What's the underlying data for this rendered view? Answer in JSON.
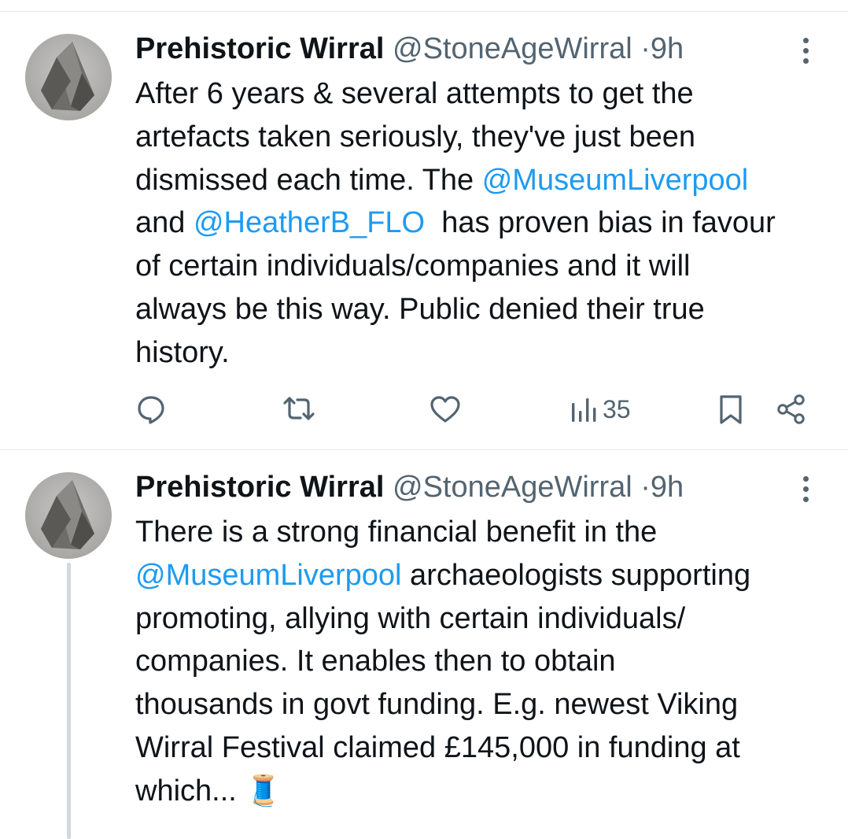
{
  "tweets": [
    {
      "name": "Prehistoric Wirral",
      "handle": "@StoneAgeWirral",
      "separator": "·",
      "time": "9h",
      "text": {
        "l1": "After 6 years & several attempts to get the",
        "l2": "artefacts taken seriously, they've just been",
        "l3a": "dismissed each time. The ",
        "l3b": "@MuseumLiverpool",
        "l4a": "and ",
        "l4b": "@HeatherB_FLO",
        "l4c": "  has proven bias in favour",
        "l5": "of certain individuals/companies and it will",
        "l6": "always be this way. Public denied their true",
        "l7": "history."
      },
      "actions": {
        "reply_icon": "reply-icon",
        "retweet_icon": "retweet-icon",
        "like_icon": "heart-icon",
        "views_icon": "views-icon",
        "views_count": "35",
        "bookmark_icon": "bookmark-icon",
        "share_icon": "share-icon"
      }
    },
    {
      "name": "Prehistoric Wirral",
      "handle": "@StoneAgeWirral",
      "separator": "·",
      "time": "9h",
      "text": {
        "l1": "There is a strong financial benefit in the",
        "l2a": "@MuseumLiverpool",
        "l2b": " archaeologists supporting",
        "l3": "promoting, allying with certain individuals/",
        "l4": "companies. It enables then to obtain",
        "l5": "thousands in govt funding. E.g. newest Viking",
        "l6": "Wirral Festival claimed £145,000 in funding at",
        "l7": "which... ",
        "emoji": "🧵"
      }
    }
  ],
  "colors": {
    "text": "#0f1419",
    "secondary": "#536471",
    "link": "#1d9bf0",
    "divider": "#e6e9ec",
    "thread_line": "#cfd9de"
  }
}
